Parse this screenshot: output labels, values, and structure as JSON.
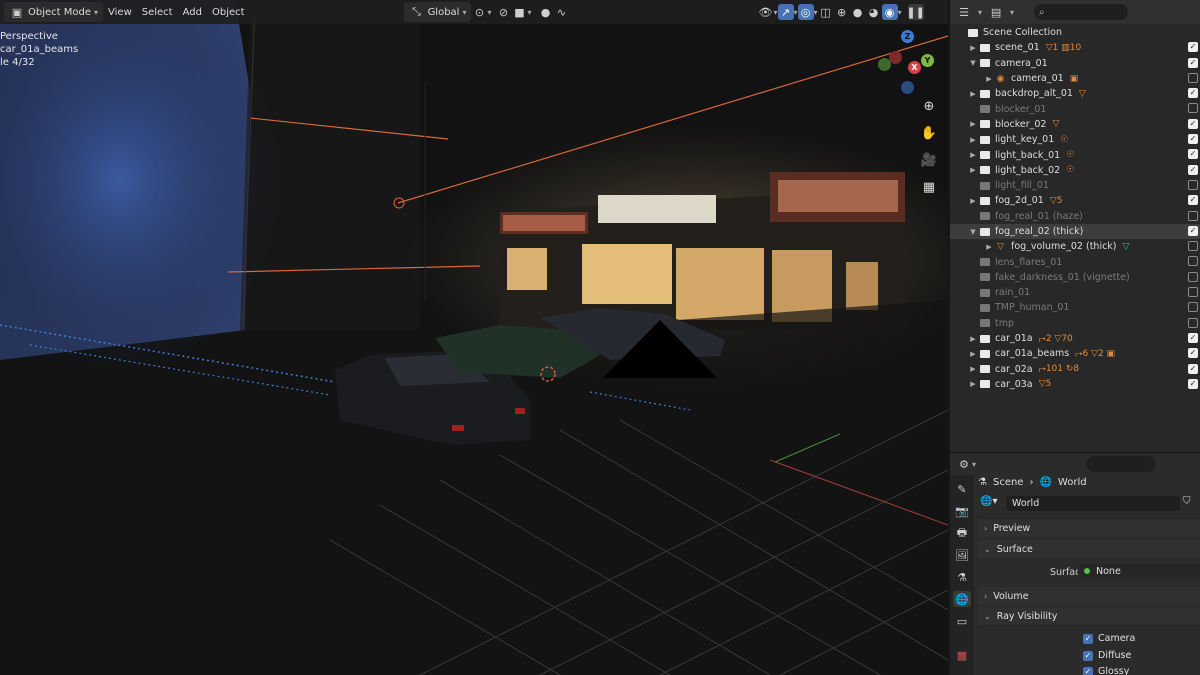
{
  "viewport": {
    "header": {
      "mode": "Object Mode",
      "menus": [
        "View",
        "Select",
        "Add",
        "Object"
      ],
      "orientation": "Global"
    },
    "overlay": {
      "line1": "Perspective",
      "line2": "car_01a_beams",
      "line3": "le 4/32"
    },
    "gizmo": {
      "z": "Z",
      "x": "X",
      "y": "Y"
    }
  },
  "outliner": {
    "root": "Scene Collection",
    "items": [
      {
        "label": "scene_01",
        "badge": "▽1 ▥10",
        "expanded": false,
        "dim": false,
        "checked": true,
        "indent": 0
      },
      {
        "label": "camera_01",
        "badge": "",
        "expanded": true,
        "dim": false,
        "checked": true,
        "indent": 0
      },
      {
        "label": "camera_01",
        "badge": "▣",
        "expanded": false,
        "dim": false,
        "checked": false,
        "indent": 1,
        "child": true
      },
      {
        "label": "backdrop_alt_01",
        "badge": "▽",
        "expanded": false,
        "dim": false,
        "checked": true,
        "indent": 0
      },
      {
        "label": "blocker_01",
        "badge": "",
        "expanded": null,
        "dim": true,
        "checked": false,
        "indent": 0
      },
      {
        "label": "blocker_02",
        "badge": "▽",
        "expanded": false,
        "dim": false,
        "checked": true,
        "indent": 0
      },
      {
        "label": "light_key_01",
        "badge": "☉",
        "expanded": false,
        "dim": false,
        "checked": true,
        "indent": 0
      },
      {
        "label": "light_back_01",
        "badge": "☉",
        "expanded": false,
        "dim": false,
        "checked": true,
        "indent": 0
      },
      {
        "label": "light_back_02",
        "badge": "☉",
        "expanded": false,
        "dim": false,
        "checked": true,
        "indent": 0
      },
      {
        "label": "light_fill_01",
        "badge": "",
        "expanded": null,
        "dim": true,
        "checked": false,
        "indent": 0
      },
      {
        "label": "fog_2d_01",
        "badge": "▽5",
        "expanded": false,
        "dim": false,
        "checked": true,
        "indent": 0
      },
      {
        "label": "fog_real_01 (haze)",
        "badge": "",
        "expanded": null,
        "dim": true,
        "checked": false,
        "indent": 0
      },
      {
        "label": "fog_real_02 (thick)",
        "badge": "",
        "expanded": true,
        "dim": false,
        "checked": true,
        "indent": 0,
        "selected": true
      },
      {
        "label": "fog_volume_02 (thick)",
        "badge": "▽",
        "expanded": false,
        "dim": false,
        "checked": false,
        "indent": 1,
        "child": true,
        "teal": true
      },
      {
        "label": "lens_flares_01",
        "badge": "",
        "expanded": null,
        "dim": true,
        "checked": false,
        "indent": 0
      },
      {
        "label": "fake_darkness_01 (vignette)",
        "badge": "",
        "expanded": null,
        "dim": true,
        "checked": false,
        "indent": 0
      },
      {
        "label": "rain_01",
        "badge": "",
        "expanded": null,
        "dim": true,
        "checked": false,
        "indent": 0
      },
      {
        "label": "TMP_human_01",
        "badge": "",
        "expanded": null,
        "dim": true,
        "checked": false,
        "indent": 0
      },
      {
        "label": "tmp",
        "badge": "",
        "expanded": null,
        "dim": true,
        "checked": false,
        "indent": 0
      },
      {
        "label": "car_01a",
        "badge": "⮣2 ▽70",
        "expanded": false,
        "dim": false,
        "checked": true,
        "indent": 0
      },
      {
        "label": "car_01a_beams",
        "badge": "⮣6 ▽2 ▣",
        "expanded": false,
        "dim": false,
        "checked": true,
        "indent": 0
      },
      {
        "label": "car_02a",
        "badge": "⮣101 ↻8",
        "expanded": false,
        "dim": false,
        "checked": true,
        "indent": 0
      },
      {
        "label": "car_03a",
        "badge": "▽5",
        "expanded": false,
        "dim": false,
        "checked": true,
        "indent": 0
      }
    ]
  },
  "properties": {
    "breadcrumb": [
      "Scene",
      "World"
    ],
    "world_name": "World",
    "panels": {
      "preview": "Preview",
      "surface": "Surface",
      "volume": "Volume",
      "ray_visibility": "Ray Visibility"
    },
    "surface_label": "Surface",
    "surface_value": "None",
    "ray": [
      "Camera",
      "Diffuse",
      "Glossy"
    ]
  }
}
